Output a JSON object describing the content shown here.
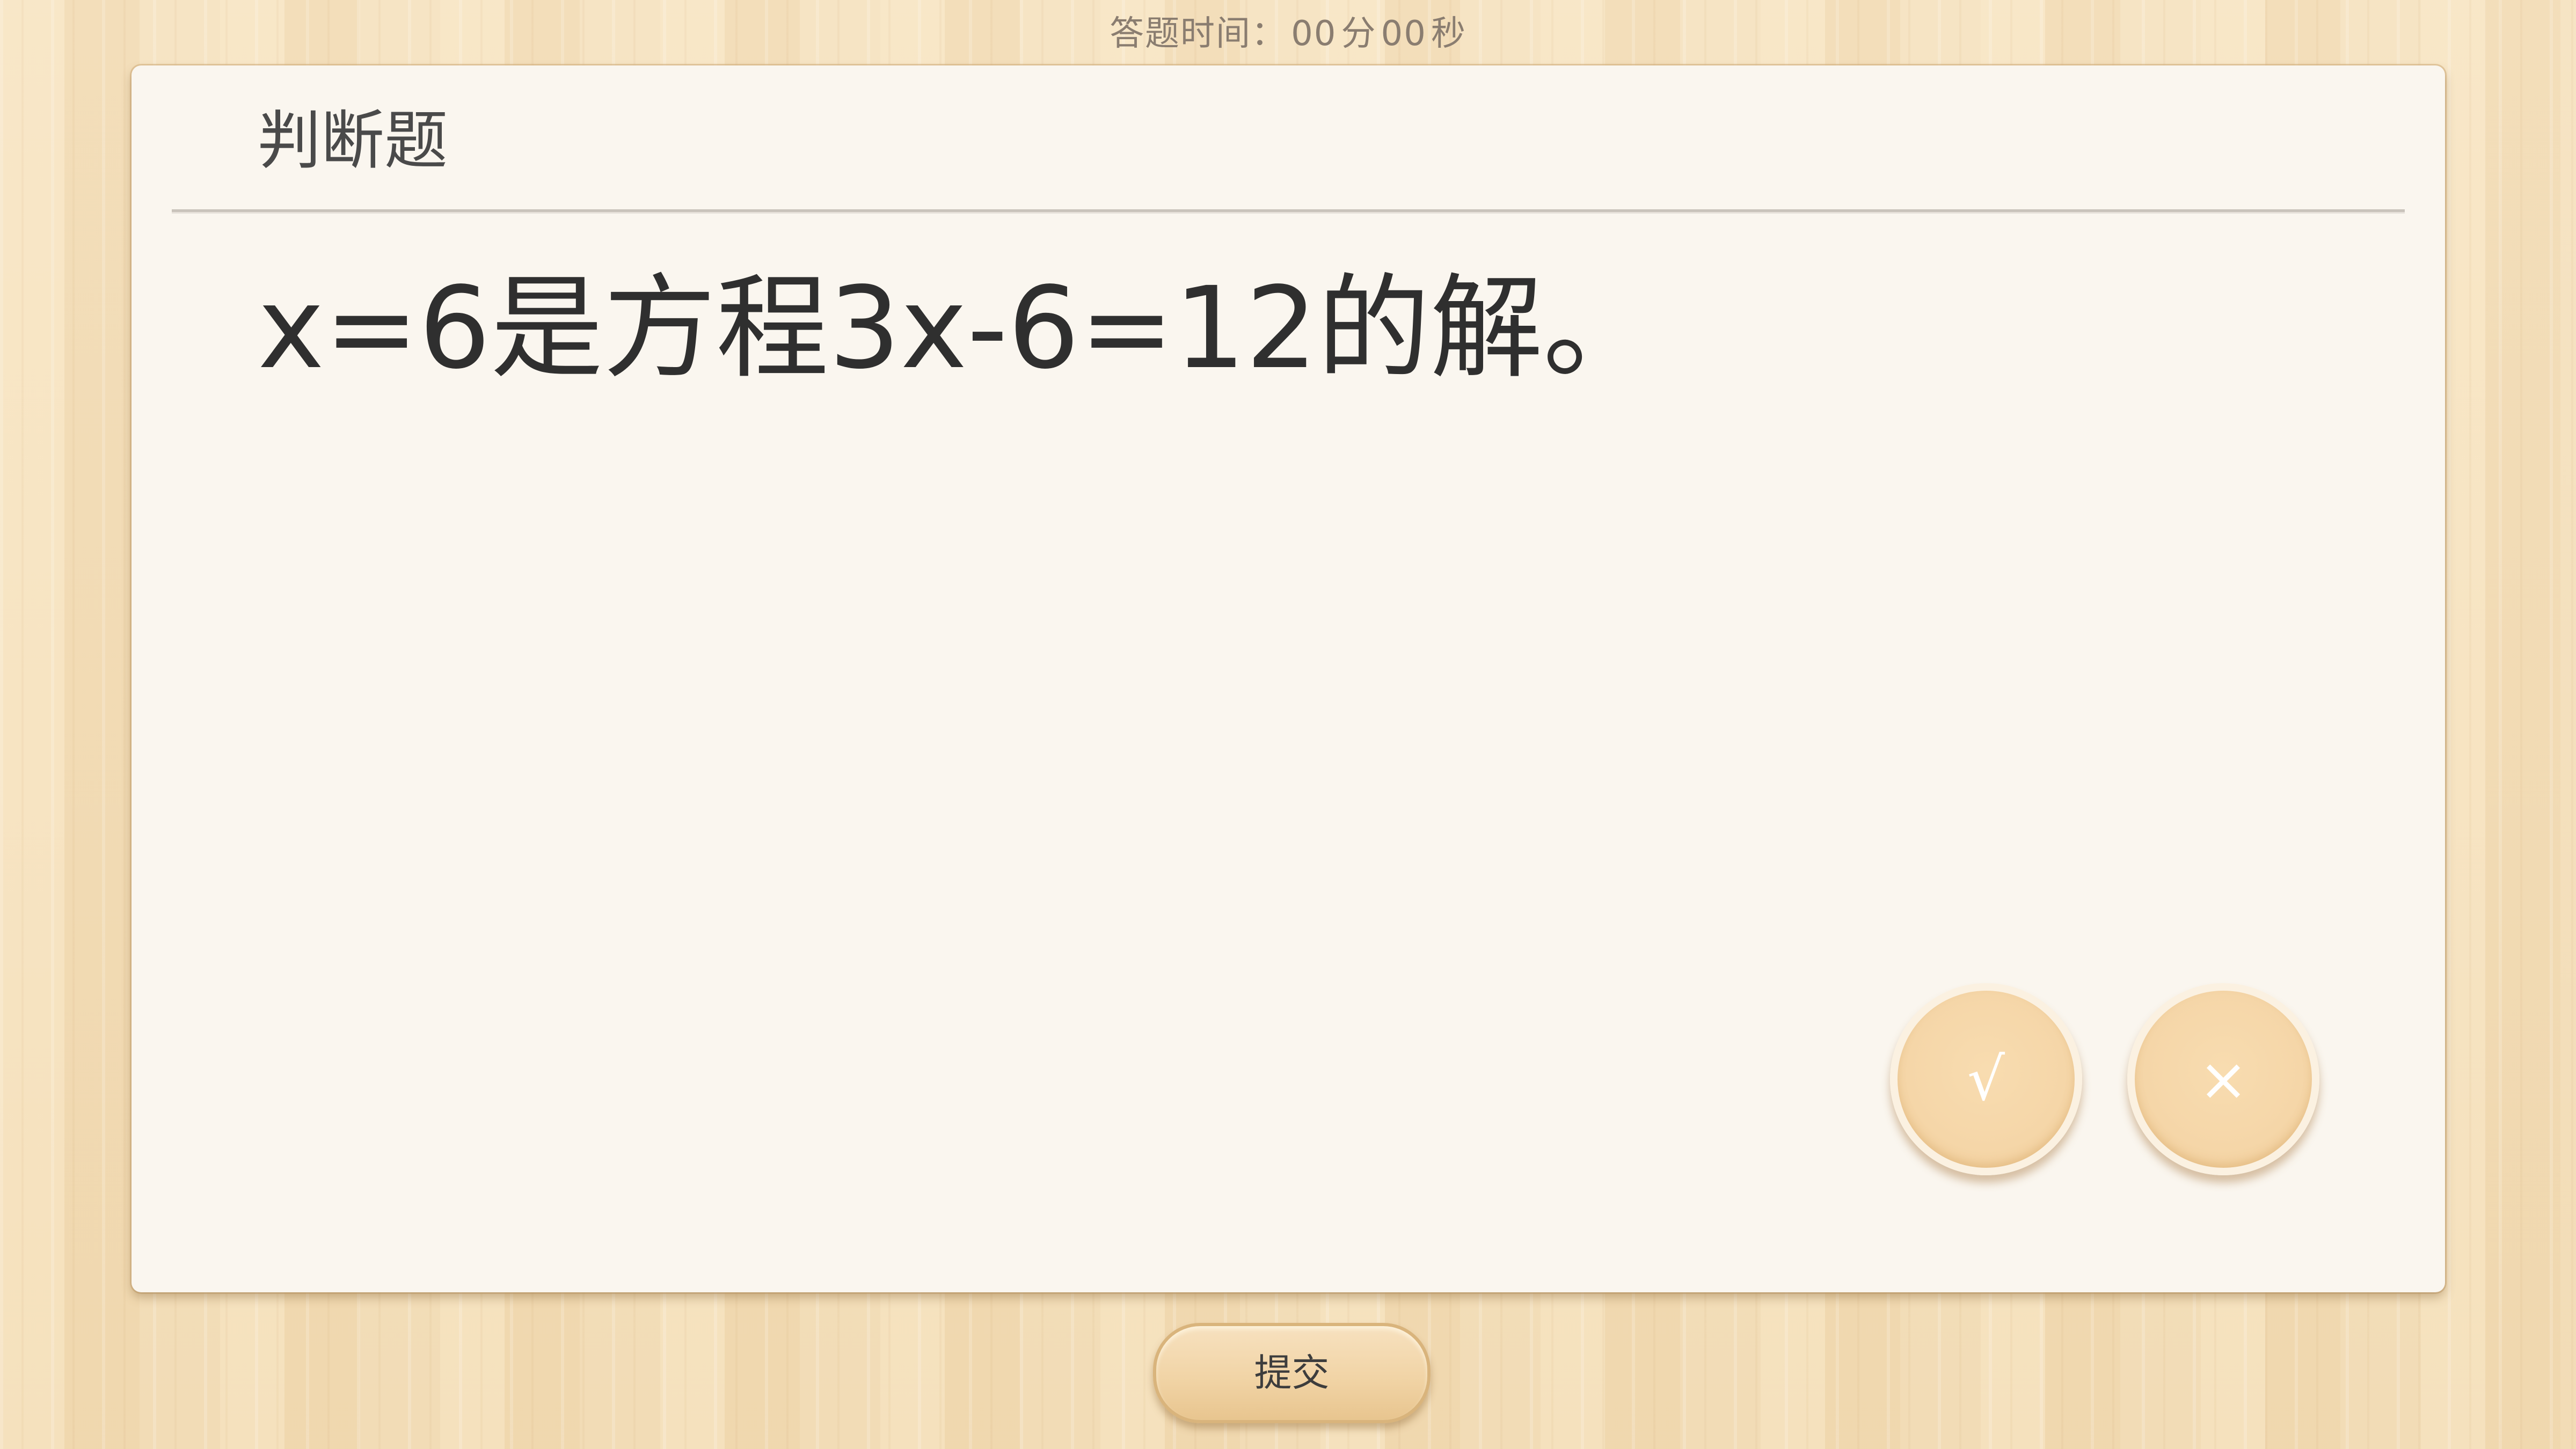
{
  "timer": {
    "label": "答题时间：",
    "minutes": "00",
    "minutes_unit": "分",
    "seconds": "00",
    "seconds_unit": "秒"
  },
  "card": {
    "title": "判断题",
    "question": "x=6是方程3x-6=12的解。"
  },
  "choices": {
    "true_label": "√",
    "false_label": "×"
  },
  "submit_label": "提交"
}
